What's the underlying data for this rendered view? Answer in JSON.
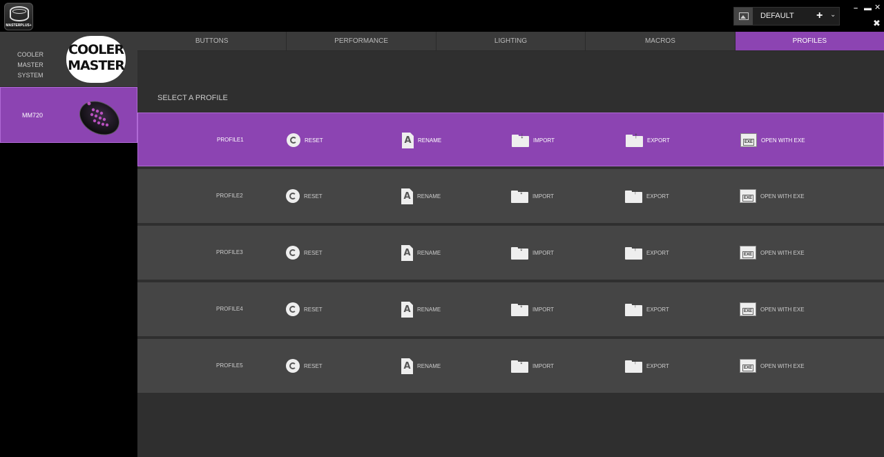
{
  "app": {
    "logo_text": "MASTERPLUS+"
  },
  "header": {
    "profile_selector": {
      "current": "DEFAULT",
      "add_label": "+",
      "chevron": "⌄"
    },
    "window_controls": {
      "minimize": "–",
      "maximize": "▬",
      "close": "✕",
      "tools": "✖"
    }
  },
  "sidebar": {
    "brand": {
      "label": "COOLER MASTER SYSTEM",
      "logo_line1": "COOLER",
      "logo_line2": "MASTER"
    },
    "device": {
      "name": "MM720"
    }
  },
  "tabs": [
    {
      "label": "BUTTONS",
      "active": false
    },
    {
      "label": "PERFORMANCE",
      "active": false
    },
    {
      "label": "LIGHTING",
      "active": false
    },
    {
      "label": "MACROS",
      "active": false
    },
    {
      "label": "PROFILES",
      "active": true
    }
  ],
  "main": {
    "section_title": "SELECT A PROFILE",
    "actions": {
      "reset": "RESET",
      "rename": "RENAME",
      "import": "IMPORT",
      "export": "EXPORT",
      "exe": "OPEN WITH EXE"
    },
    "icons": {
      "rename_glyph": "A",
      "exe_glyph": "EXE",
      "import_arrow": "↓",
      "export_arrow": "↑"
    },
    "profiles": [
      {
        "name": "PROFILE1",
        "active": true
      },
      {
        "name": "PROFILE2",
        "active": false
      },
      {
        "name": "PROFILE3",
        "active": false
      },
      {
        "name": "PROFILE4",
        "active": false
      },
      {
        "name": "PROFILE5",
        "active": false
      }
    ]
  },
  "colors": {
    "accent": "#8c44b2",
    "panel": "#3a3a3a",
    "row": "#454545",
    "background": "#2f2f2f"
  }
}
